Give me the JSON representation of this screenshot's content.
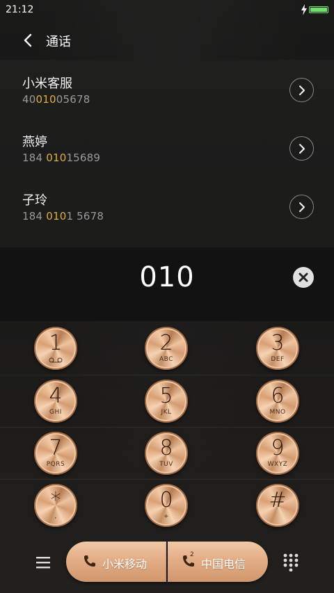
{
  "status": {
    "time": "21:12",
    "battery_level": 1.0,
    "battery_color": "#6fe06b"
  },
  "header": {
    "title": "通话",
    "back_icon": "chevron-left-icon"
  },
  "contacts": [
    {
      "name": "小米客服",
      "number_pre": "40",
      "number_match": "010",
      "number_post": "05678"
    },
    {
      "name": "燕婷",
      "number_pre": "184 ",
      "number_match": "010",
      "number_post": "15689"
    },
    {
      "name": "子玲",
      "number_pre": "184 ",
      "number_match": "010",
      "number_post": "1 5678"
    }
  ],
  "dial": {
    "digits": "010"
  },
  "keys": [
    {
      "digit": "1",
      "letters": "",
      "icon": "voicemail-icon"
    },
    {
      "digit": "2",
      "letters": "ABC"
    },
    {
      "digit": "3",
      "letters": "DEF"
    },
    {
      "digit": "4",
      "letters": "GHI"
    },
    {
      "digit": "5",
      "letters": "JKL"
    },
    {
      "digit": "6",
      "letters": "MNO"
    },
    {
      "digit": "7",
      "letters": "PQRS"
    },
    {
      "digit": "8",
      "letters": "TUV"
    },
    {
      "digit": "9",
      "letters": "WXYZ"
    },
    {
      "digit": "*",
      "letters": ","
    },
    {
      "digit": "0",
      "letters": "+"
    },
    {
      "digit": "#",
      "letters": ""
    }
  ],
  "bottom": {
    "sim1_label": "小米移动",
    "sim2_label": "中国电信",
    "sim2_badge": "2"
  },
  "colors": {
    "match_highlight": "#e0b040",
    "key_gold": "#e3ad86"
  }
}
